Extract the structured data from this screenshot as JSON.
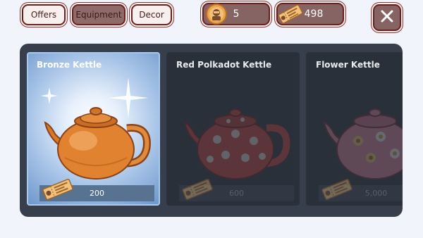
{
  "tabs": [
    {
      "label": "Offers",
      "active": false
    },
    {
      "label": "Equipment",
      "active": true
    },
    {
      "label": "Decor",
      "active": false
    }
  ],
  "currencies": [
    {
      "name": "coin-icon",
      "value": "5"
    },
    {
      "name": "ticket-icon",
      "value": "498"
    }
  ],
  "close_icon": "close-icon",
  "items": [
    {
      "title": "Bronze Kettle",
      "price": "200",
      "state": "selected"
    },
    {
      "title": "Red Polkadot Kettle",
      "price": "600",
      "state": "locked"
    },
    {
      "title": "Flower Kettle",
      "price": "5,000",
      "state": "locked"
    }
  ],
  "colors": {
    "accent_border": "#6b1f1f",
    "panel_bg": "#363f4b",
    "selected_card": "#a9c5e8",
    "price_bar": "#587292"
  }
}
